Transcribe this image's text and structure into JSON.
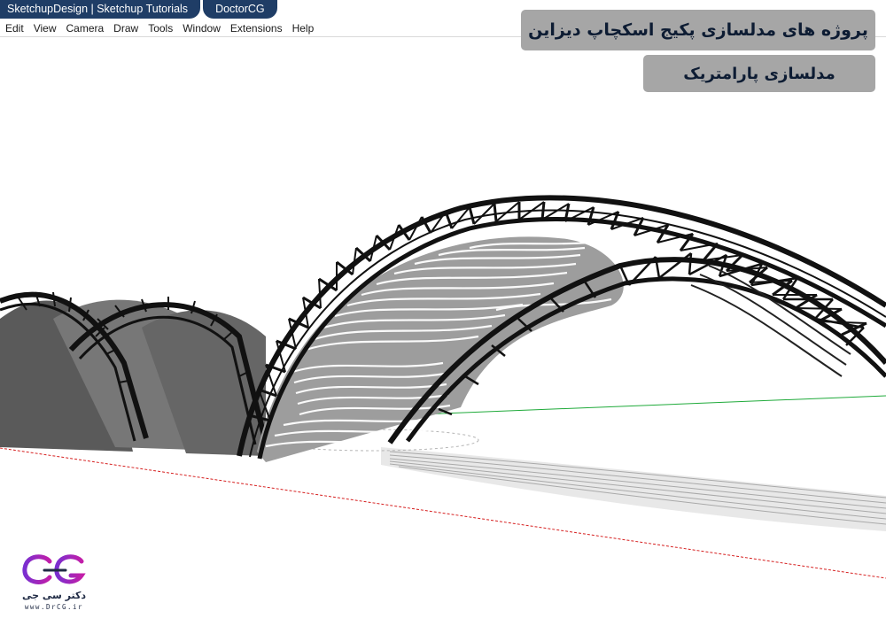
{
  "tabs": [
    {
      "label": "SketchupDesign | Sketchup Tutorials"
    },
    {
      "label": "DoctorCG"
    }
  ],
  "menu": [
    {
      "label": "Edit"
    },
    {
      "label": "View"
    },
    {
      "label": "Camera"
    },
    {
      "label": "Draw"
    },
    {
      "label": "Tools"
    },
    {
      "label": "Window"
    },
    {
      "label": "Extensions"
    },
    {
      "label": "Help"
    }
  ],
  "titles": {
    "main": "پروژه های مدلسازی پکیج اسکچاپ دیزاین",
    "sub": "مدلسازی پارامتریک"
  },
  "logo": {
    "name_fa": "دکتر سی جی",
    "url": "www.DrCG.ir",
    "colors": {
      "primary": "#7a2fd0",
      "secondary": "#c21ea8"
    }
  },
  "viewport": {
    "axis_colors": {
      "red": "#d62020",
      "green": "#1faa3a"
    },
    "background": "#ffffff"
  },
  "theme": {
    "tab_bg": "#1f3d66",
    "title_bg": "#a6a6a6",
    "title_text": "#0d1c33"
  }
}
